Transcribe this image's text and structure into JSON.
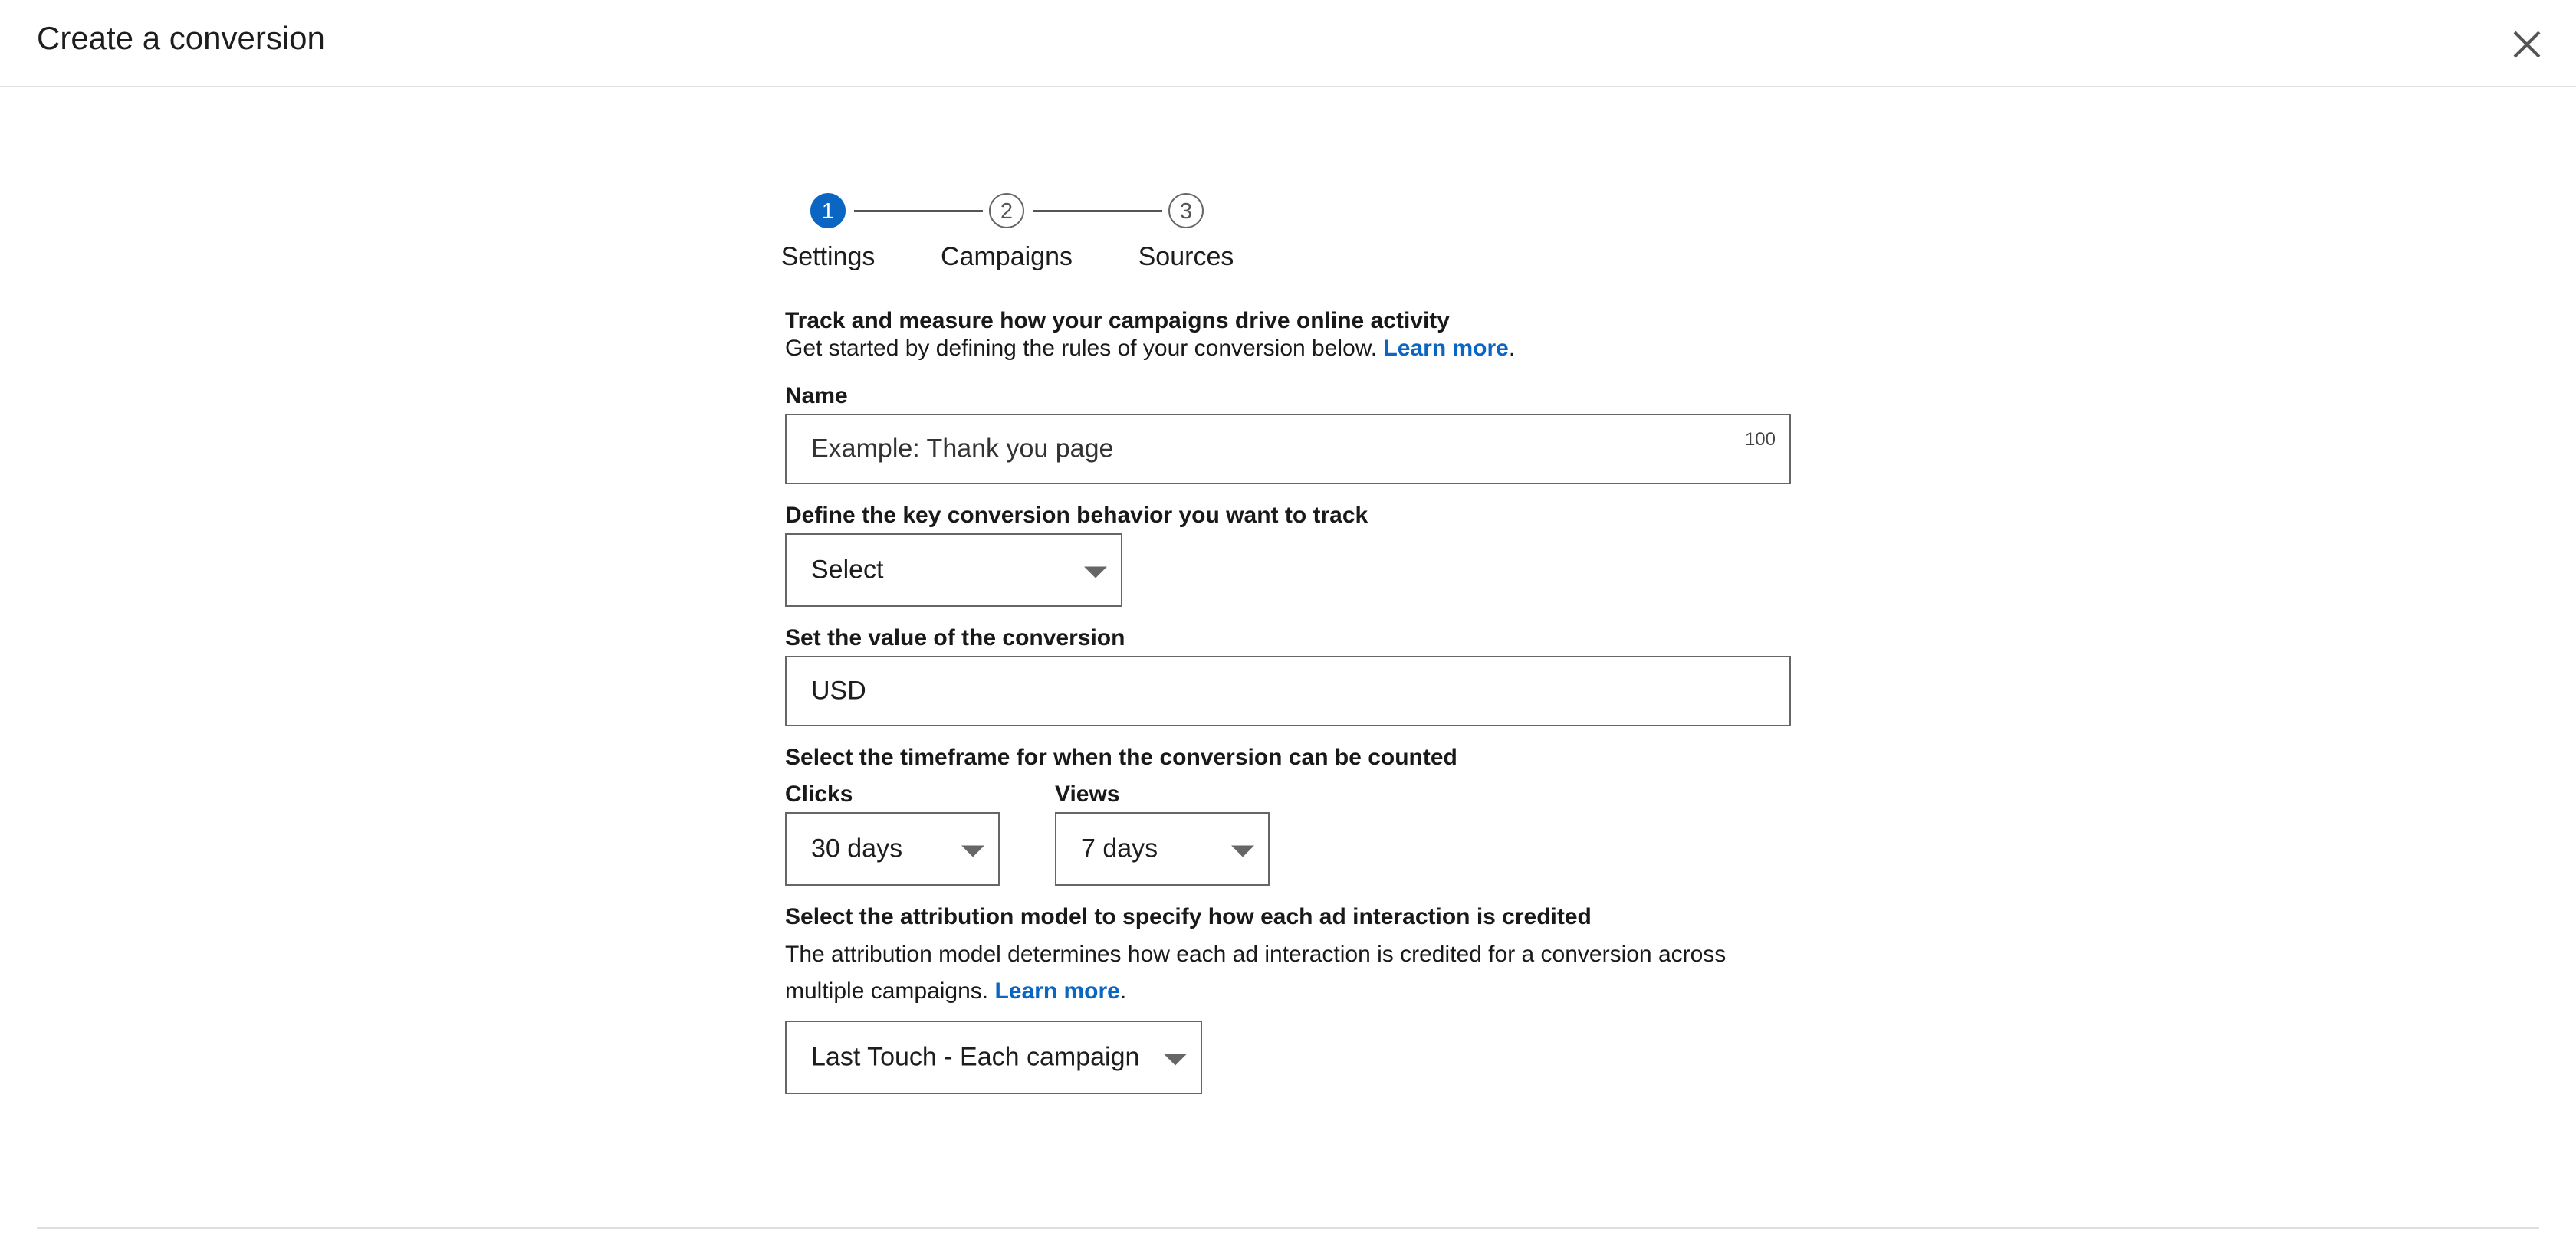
{
  "header": {
    "title": "Create a conversion",
    "close_icon": "close-icon"
  },
  "stepper": {
    "steps": [
      {
        "number": "1",
        "label": "Settings",
        "state": "active"
      },
      {
        "number": "2",
        "label": "Campaigns",
        "state": "todo"
      },
      {
        "number": "3",
        "label": "Sources",
        "state": "todo"
      }
    ]
  },
  "intro": {
    "title": "Track and measure how your campaigns drive online activity",
    "subtitle": "Get started by defining the rules of your conversion below.",
    "learn_more": "Learn more",
    "period": "."
  },
  "name_field": {
    "label": "Name",
    "placeholder": "Example: Thank you page",
    "char_limit": "100"
  },
  "behavior_field": {
    "label": "Define the key conversion behavior you want to track",
    "value": "Select"
  },
  "value_field": {
    "label": "Set the value of the conversion",
    "value": "USD"
  },
  "timeframe": {
    "label": "Select the timeframe for when the conversion can be counted",
    "clicks": {
      "label": "Clicks",
      "value": "30 days"
    },
    "views": {
      "label": "Views",
      "value": "7 days"
    }
  },
  "attribution": {
    "label": "Select the attribution model to specify how each ad interaction is credited",
    "description": "The attribution model determines how each ad interaction is credited for a conversion across multiple campaigns.",
    "learn_more": "Learn more",
    "period": ".",
    "value": "Last Touch - Each campaign"
  },
  "colors": {
    "accent": "#0a66c2",
    "border": "#666666",
    "divider": "#e0e0e0"
  }
}
